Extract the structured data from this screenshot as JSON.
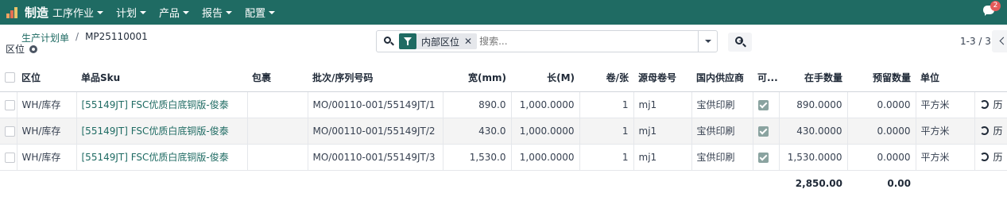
{
  "navbar": {
    "app_name": "制造",
    "menu": [
      "工序作业",
      "计划",
      "产品",
      "报告",
      "配置"
    ],
    "messages_count": "2",
    "brand_color": "#1f6b63"
  },
  "breadcrumb": {
    "parent": "生产计划单",
    "current": "MP25110001"
  },
  "page_title": "区位",
  "search": {
    "facet_label": "内部区位",
    "remove_symbol": "✕",
    "placeholder": "搜索..."
  },
  "pager": "1-3 / 3",
  "table": {
    "columns": [
      "区位",
      "单品Sku",
      "包裹",
      "批次/序列号码",
      "宽(mm)",
      "长(M)",
      "卷/张",
      "源母卷号",
      "国内供应商",
      "可...",
      "在手数量",
      "预留数量",
      "单位"
    ],
    "rows": [
      {
        "location": "WH/库存",
        "sku": "[55149JT] FSC优质白底铜版-俊泰",
        "package": "",
        "lot": "MO/00110-001/55149JT/1",
        "width": "890.0",
        "length": "1,000.0000",
        "rolls": "1",
        "parent_roll": "mj1",
        "supplier": "宝供印刷",
        "available": true,
        "on_hand": "890.0000",
        "reserved": "0.0000",
        "uom": "平方米",
        "history": "历"
      },
      {
        "location": "WH/库存",
        "sku": "[55149JT] FSC优质白底铜版-俊泰",
        "package": "",
        "lot": "MO/00110-001/55149JT/2",
        "width": "430.0",
        "length": "1,000.0000",
        "rolls": "1",
        "parent_roll": "mj1",
        "supplier": "宝供印刷",
        "available": true,
        "on_hand": "430.0000",
        "reserved": "0.0000",
        "uom": "平方米",
        "history": "历"
      },
      {
        "location": "WH/库存",
        "sku": "[55149JT] FSC优质白底铜版-俊泰",
        "package": "",
        "lot": "MO/00110-001/55149JT/3",
        "width": "1,530.0",
        "length": "1,000.0000",
        "rolls": "1",
        "parent_roll": "mj1",
        "supplier": "宝供印刷",
        "available": true,
        "on_hand": "1,530.0000",
        "reserved": "0.0000",
        "uom": "平方米",
        "history": "历"
      }
    ],
    "totals": {
      "on_hand": "2,850.00",
      "reserved": "0.00"
    }
  }
}
